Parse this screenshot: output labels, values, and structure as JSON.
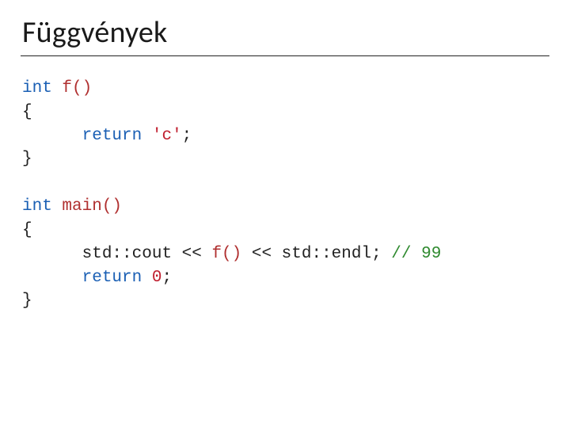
{
  "title": "Függvények",
  "code": {
    "l1_kw": "int",
    "l1_fn": " f()",
    "l2": "{",
    "l3_kw": "return",
    "l3_sp": " ",
    "l3_lit": "'c'",
    "l3_end": ";",
    "l4": "}",
    "l6_kw": "int",
    "l6_fn": " main()",
    "l7": "{",
    "l8a": "std::cout << ",
    "l8_fn": "f()",
    "l8b": " << std::endl; ",
    "l8_cmt": "// 99",
    "l9_kw": "return",
    "l9_sp": " ",
    "l9_num": "0",
    "l9_end": ";",
    "l10": "}"
  }
}
